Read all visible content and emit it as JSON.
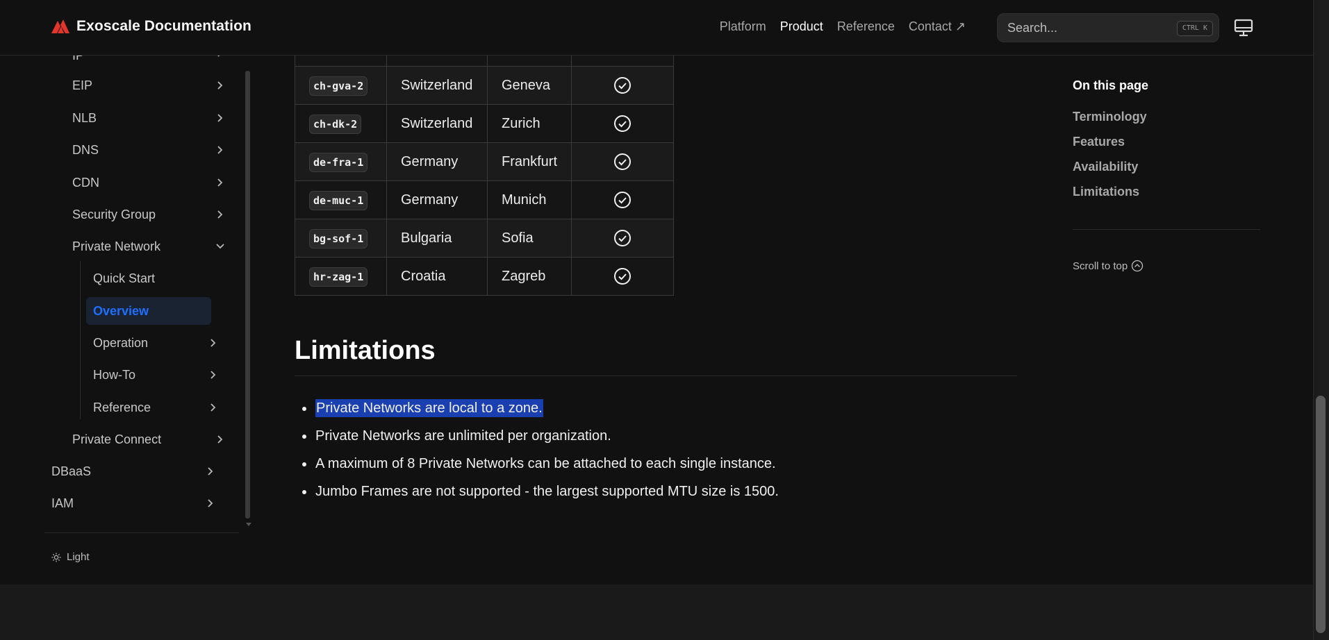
{
  "header": {
    "brand": "Exoscale Documentation",
    "nav": [
      {
        "label": "Platform",
        "active": false
      },
      {
        "label": "Product",
        "active": true
      },
      {
        "label": "Reference",
        "active": false
      },
      {
        "label": "Contact ↗",
        "active": false
      }
    ],
    "search": {
      "placeholder": "Search...",
      "shortcut": "CTRL K"
    },
    "accent_color": "#e2352b"
  },
  "sidebar": {
    "partial_top_item": "IP",
    "items": [
      {
        "label": "EIP"
      },
      {
        "label": "NLB"
      },
      {
        "label": "DNS"
      },
      {
        "label": "CDN"
      },
      {
        "label": "Security Group"
      },
      {
        "label": "Private Network",
        "expanded": true
      },
      {
        "label": "Quick Start"
      },
      {
        "label": "Overview",
        "active": true
      },
      {
        "label": "Operation"
      },
      {
        "label": "How-To"
      },
      {
        "label": "Reference"
      },
      {
        "label": "Private Connect"
      },
      {
        "label": "DBaaS"
      },
      {
        "label": "IAM"
      }
    ],
    "theme_toggle": "Light",
    "active_color": "#1f6fff"
  },
  "table": {
    "rows": [
      {
        "zone": "ch-gva-2",
        "country": "Switzerland",
        "city": "Geneva",
        "available": true
      },
      {
        "zone": "ch-dk-2",
        "country": "Switzerland",
        "city": "Zurich",
        "available": true
      },
      {
        "zone": "de-fra-1",
        "country": "Germany",
        "city": "Frankfurt",
        "available": true
      },
      {
        "zone": "de-muc-1",
        "country": "Germany",
        "city": "Munich",
        "available": true
      },
      {
        "zone": "bg-sof-1",
        "country": "Bulgaria",
        "city": "Sofia",
        "available": true
      },
      {
        "zone": "hr-zag-1",
        "country": "Croatia",
        "city": "Zagreb",
        "available": true
      }
    ]
  },
  "content": {
    "heading": "Limitations",
    "bullets": [
      "Private Networks are local to a zone.",
      "Private Networks are unlimited per organization.",
      "A maximum of 8 Private Networks can be attached to each single instance.",
      "Jumbo Frames are not supported - the largest supported MTU size is 1500."
    ],
    "selection_color": "#1a3fb0"
  },
  "toc": {
    "title": "On this page",
    "links": [
      "Terminology",
      "Features",
      "Availability",
      "Limitations"
    ],
    "scroll_to_top": "Scroll to top"
  }
}
